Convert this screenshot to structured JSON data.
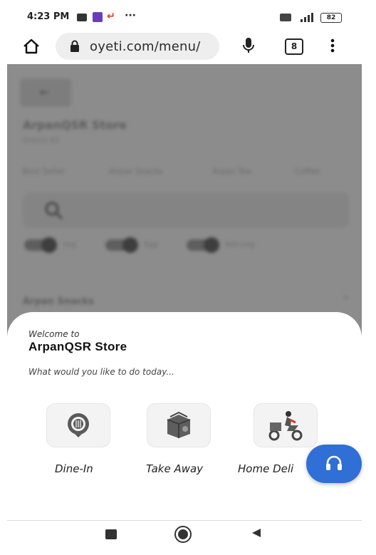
{
  "status_bar": {
    "time": "4:23 PM",
    "dots": "···",
    "battery": "82"
  },
  "browser": {
    "url": "oyeti.com/menu/",
    "tab_count": "8"
  },
  "background_page": {
    "store_title": "ArpanQSR Store",
    "store_subtitle": "Directs 62",
    "categories": [
      "Best Seller",
      "Arpan Snacks",
      "Arpan Tea",
      "Coffee"
    ],
    "filters": [
      "Veg",
      "Egg",
      "Non-veg"
    ],
    "section_heading": "Arpan Snacks"
  },
  "sheet": {
    "welcome": "Welcome to",
    "store_name": "ArpanQSR Store",
    "prompt": "What would you like to do today...",
    "options": [
      {
        "label": "Dine-In",
        "icon": "dine-in-icon"
      },
      {
        "label": "Take Away",
        "icon": "take-away-icon"
      },
      {
        "label": "Home Deli",
        "icon": "home-delivery-icon"
      }
    ]
  },
  "colors": {
    "accent": "#2f6fd6",
    "overlay": "#8c8c8c"
  }
}
